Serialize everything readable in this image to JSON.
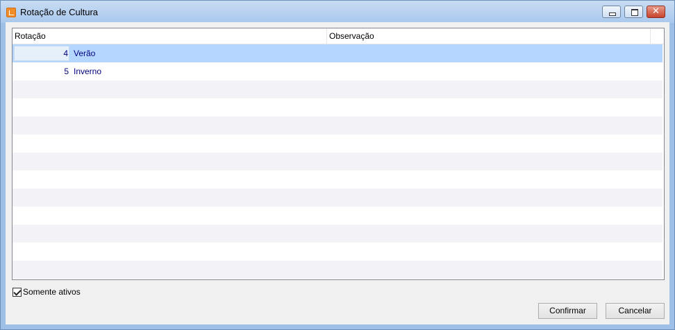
{
  "window": {
    "title": "Rotação de Cultura",
    "close_glyph": "✕"
  },
  "grid": {
    "columns": [
      "Rotação",
      "Observação"
    ],
    "rows": [
      {
        "number": "4",
        "name": "Verão",
        "observation": "",
        "selected": true
      },
      {
        "number": "5",
        "name": "Inverno",
        "observation": "",
        "selected": false
      }
    ]
  },
  "filter": {
    "label": "Somente ativos",
    "checked": true
  },
  "buttons": {
    "confirm": "Confirmar",
    "cancel": "Cancelar"
  }
}
